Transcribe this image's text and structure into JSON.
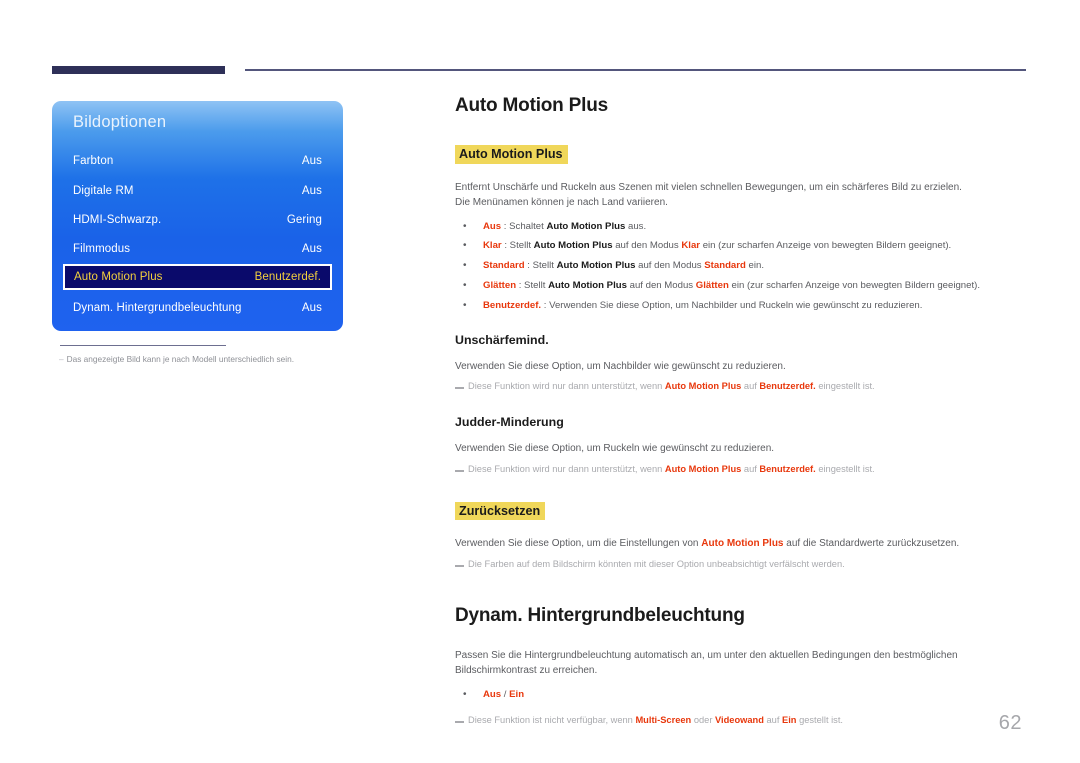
{
  "page": {
    "number": "62"
  },
  "osd": {
    "title": "Bildoptionen",
    "rows": [
      {
        "label": "Farbton",
        "value": "Aus"
      },
      {
        "label": "Digitale RM",
        "value": "Aus"
      },
      {
        "label": "HDMI-Schwarzp.",
        "value": "Gering"
      },
      {
        "label": "Filmmodus",
        "value": "Aus"
      },
      {
        "label": "Auto Motion Plus",
        "value": "Benutzerdef."
      },
      {
        "label": "Dynam. Hintergrundbeleuchtung",
        "value": "Aus"
      }
    ],
    "selected_index": 4,
    "caption_dash": "–",
    "caption": "Das angezeigte Bild kann je nach Modell unterschiedlich sein."
  },
  "content": {
    "section1_heading": "Auto Motion Plus",
    "highlight1": "Auto Motion Plus",
    "intro_line1": "Entfernt Unschärfe und Ruckeln aus Szenen mit vielen schnellen Bewegungen, um ein schärferes Bild zu erzielen.",
    "intro_line2": "Die Menünamen können je nach Land variieren.",
    "options": [
      {
        "key": "Aus",
        "sep": " : Schaltet ",
        "bold_mid": "Auto Motion Plus",
        "tail": " aus."
      },
      {
        "key": "Klar",
        "sep": " : Stellt ",
        "bold_mid": "Auto Motion Plus",
        "mid_text": " auf den Modus ",
        "key2": "Klar",
        "tail": " ein (zur scharfen Anzeige von bewegten Bildern geeignet)."
      },
      {
        "key": "Standard",
        "sep": " : Stellt ",
        "bold_mid": "Auto Motion Plus",
        "mid_text": " auf den Modus ",
        "key2": "Standard",
        "tail": " ein."
      },
      {
        "key": "Glätten",
        "sep": " : Stellt ",
        "bold_mid": "Auto Motion Plus",
        "mid_text": " auf den Modus ",
        "key2": "Glätten",
        "tail": " ein (zur scharfen Anzeige von bewegten Bildern geeignet)."
      },
      {
        "key": "Benutzerdef.",
        "sep": " : Verwenden Sie diese Option, um Nachbilder und Ruckeln wie gewünscht zu reduzieren.",
        "bold_mid": "",
        "tail": ""
      }
    ],
    "sub1_heading": "Unschärfemind.",
    "sub1_body": "Verwenden Sie diese Option, um Nachbilder wie gewünscht zu reduzieren.",
    "sub1_note_a": "Diese Funktion wird nur dann unterstützt, wenn ",
    "sub1_note_b": "Auto Motion Plus",
    "sub1_note_c": " auf ",
    "sub1_note_d": "Benutzerdef.",
    "sub1_note_e": " eingestellt ist.",
    "sub2_heading": "Judder-Minderung",
    "sub2_body": "Verwenden Sie diese Option, um Ruckeln wie gewünscht zu reduzieren.",
    "sub2_note_a": "Diese Funktion wird nur dann unterstützt, wenn ",
    "sub2_note_b": "Auto Motion Plus",
    "sub2_note_c": " auf ",
    "sub2_note_d": "Benutzerdef.",
    "sub2_note_e": " eingestellt ist.",
    "highlight2": "Zurücksetzen",
    "reset_body_a": "Verwenden Sie diese Option, um die Einstellungen von ",
    "reset_body_b": "Auto Motion Plus",
    "reset_body_c": " auf die Standardwerte zurückzusetzen.",
    "reset_note": "Die Farben auf dem Bildschirm könnten mit dieser Option unbeabsichtigt verfälscht werden.",
    "section2_heading": "Dynam. Hintergrundbeleuchtung",
    "dyn_body_line1": "Passen Sie die Hintergrundbeleuchtung automatisch an, um unter den aktuellen Bedingungen den bestmöglichen",
    "dyn_body_line2": "Bildschirmkontrast zu erreichen.",
    "dyn_opt_a": "Aus",
    "dyn_opt_sep": " / ",
    "dyn_opt_b": "Ein",
    "dyn_note_a": "Diese Funktion ist nicht verfügbar, wenn ",
    "dyn_note_b": "Multi-Screen",
    "dyn_note_c": " oder ",
    "dyn_note_d": "Videowand",
    "dyn_note_e": " auf ",
    "dyn_note_f": "Ein",
    "dyn_note_g": " gestellt ist."
  },
  "colors": {
    "accent_red": "#e8380d",
    "highlight_yellow": "#f0d75a",
    "osd_blue": "#1a62e8",
    "osd_selected": "#0a0a6b",
    "osd_selected_text": "#f4d13d",
    "rule_navy": "#2e3058"
  }
}
